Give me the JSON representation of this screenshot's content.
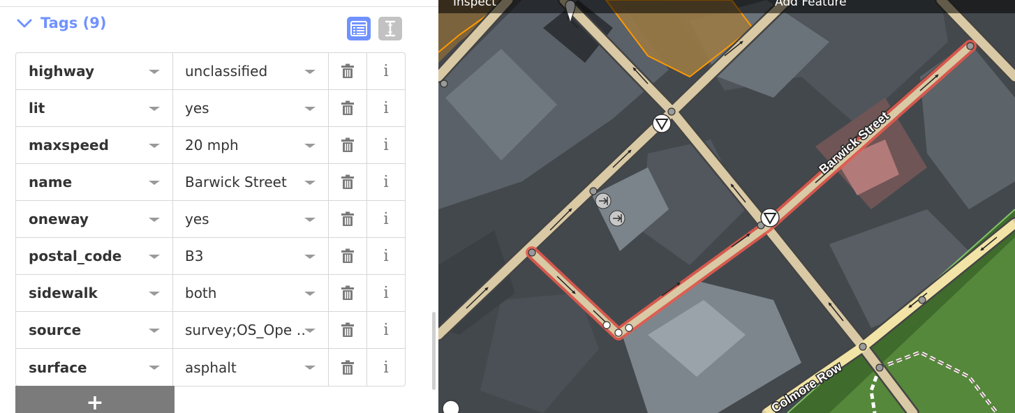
{
  "sidebar": {
    "tags_title": "Tags (9)",
    "view_list_icon": "list-view-icon",
    "view_text_icon": "text-view-icon",
    "add_label": "+",
    "tags": [
      {
        "key": "highway",
        "value": "unclassified"
      },
      {
        "key": "lit",
        "value": "yes"
      },
      {
        "key": "maxspeed",
        "value": "20 mph"
      },
      {
        "key": "name",
        "value": "Barwick Street"
      },
      {
        "key": "oneway",
        "value": "yes"
      },
      {
        "key": "postal_code",
        "value": "B3"
      },
      {
        "key": "sidewalk",
        "value": "both"
      },
      {
        "key": "source",
        "value": "survey;OS_Ope …"
      },
      {
        "key": "surface",
        "value": "asphalt"
      }
    ],
    "delete_icon": "trash-icon",
    "info_icon": "info-icon",
    "info_glyph": "i"
  },
  "map": {
    "toolbar": {
      "inspect_label": "Inspect",
      "add_feature_label": "Add Feature"
    },
    "street_labels": {
      "barwick": "Barwick Street",
      "colmore": "Colmore Row"
    },
    "colors": {
      "selection": "#e55b4e",
      "road": "#d9c9a5",
      "building_highlight": "#ff9900",
      "accent": "#7092ff"
    }
  }
}
